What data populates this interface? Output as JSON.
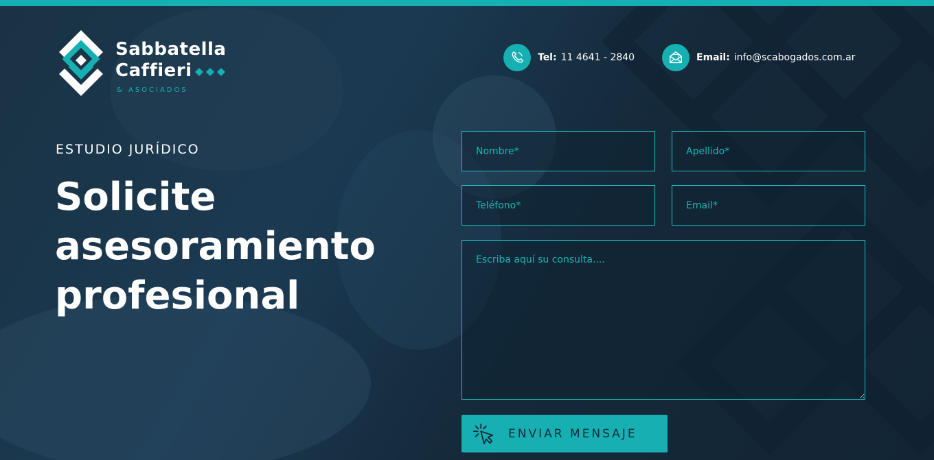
{
  "brand": {
    "name_line1": "Sabbatella",
    "name_line2": "Caffieri",
    "sub": "& ASOCIADOS"
  },
  "contact": {
    "tel_label": "Tel:",
    "tel_value": "11 4641 - 2840",
    "email_label": "Email:",
    "email_value": "info@scabogados.com.ar"
  },
  "hero": {
    "eyebrow": "ESTUDIO JURÍDICO",
    "headline_line1": "Solicite",
    "headline_line2": "asesoramiento",
    "headline_line3": "profesional"
  },
  "form": {
    "nombre_placeholder": "Nombre*",
    "apellido_placeholder": "Apellido*",
    "telefono_placeholder": "Teléfono*",
    "email_placeholder": "Email*",
    "consulta_placeholder": "Escriba aquí su consulta....",
    "submit_label": "ENVIAR MENSAJE"
  },
  "colors": {
    "accent": "#16b0b3",
    "background": "#1b3a52",
    "text": "#ffffff"
  },
  "icons": {
    "tel": "phone-icon",
    "email": "envelope-icon",
    "submit": "cursor-click-icon"
  }
}
